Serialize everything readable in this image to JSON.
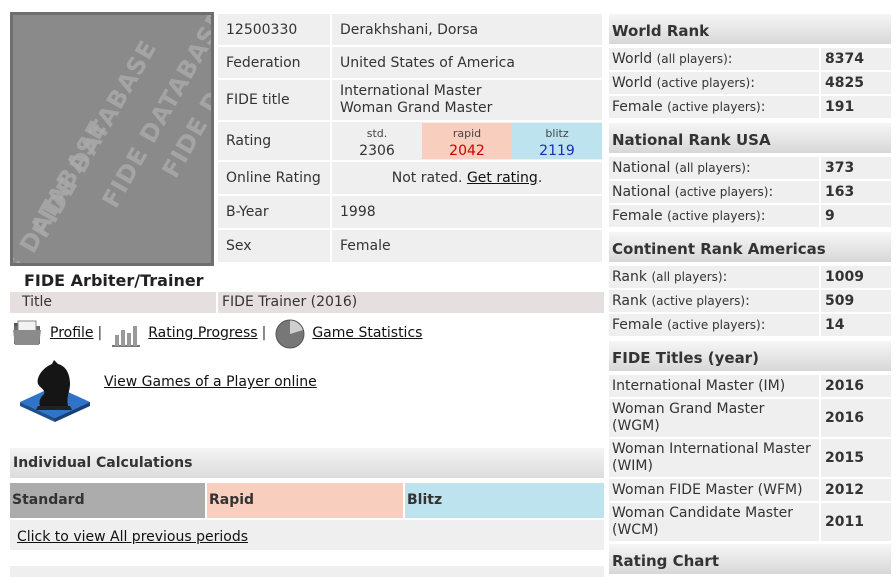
{
  "player": {
    "id": "12500330",
    "name": "Derakhshani, Dorsa",
    "federation_label": "Federation",
    "federation": "United States of America",
    "title_label": "FIDE title",
    "title_line1": "International Master",
    "title_line2": "Woman Grand Master",
    "rating_label": "Rating",
    "std_label": "std.",
    "std_value": "2306",
    "rapid_label": "rapid",
    "rapid_value": "2042",
    "blitz_label": "blitz",
    "blitz_value": "2119",
    "online_label": "Online Rating",
    "online_text": "Not rated.",
    "online_link": "Get rating",
    "online_period": ".",
    "byear_label": "B-Year",
    "byear": "1998",
    "sex_label": "Sex",
    "sex": "Female",
    "photo_watermark": [
      "FIDE DATABASE",
      "FIDE DATABASE",
      "FIDE DATABASE",
      "FIDE DATABASE"
    ]
  },
  "arbiter": {
    "heading": "FIDE Arbiter/Trainer",
    "title_label": "Title",
    "title_value": "FIDE Trainer (2016)"
  },
  "links": {
    "profile": "Profile",
    "sep": "|",
    "rating_progress": "Rating Progress",
    "game_statistics": "Game Statistics",
    "view_games": "View Games of a Player online"
  },
  "calc": {
    "heading": "Individual Calculations",
    "standard": "Standard",
    "rapid": "Rapid",
    "blitz": "Blitz",
    "prev": "Click to view All previous periods"
  },
  "world_rank": {
    "heading": "World Rank",
    "rows": [
      {
        "label": "World",
        "sub": "(all players)",
        "colon": ":",
        "value": "8374"
      },
      {
        "label": "World",
        "sub": "(active players)",
        "colon": ":",
        "value": "4825"
      },
      {
        "label": "Female",
        "sub": "(active players)",
        "colon": ":",
        "value": "191"
      }
    ]
  },
  "national_rank": {
    "heading": "National Rank USA",
    "rows": [
      {
        "label": "National",
        "sub": "(all players)",
        "colon": ":",
        "value": "373"
      },
      {
        "label": "National",
        "sub": "(active players)",
        "colon": ":",
        "value": "163"
      },
      {
        "label": "Female",
        "sub": "(active players)",
        "colon": ":",
        "value": "9"
      }
    ]
  },
  "continent_rank": {
    "heading": "Continent Rank Americas",
    "rows": [
      {
        "label": "Rank",
        "sub": "(all players)",
        "colon": ":",
        "value": "1009"
      },
      {
        "label": "Rank",
        "sub": "(active players)",
        "colon": ":",
        "value": "509"
      },
      {
        "label": "Female",
        "sub": "(active players)",
        "colon": ":",
        "value": "14"
      }
    ]
  },
  "fide_titles": {
    "heading": "FIDE Titles (year)",
    "rows": [
      {
        "line1": "International Master (IM)",
        "line2": "",
        "year": "2016"
      },
      {
        "line1": "Woman Grand Master",
        "line2": "(WGM)",
        "year": "2016"
      },
      {
        "line1": "Woman International Master",
        "line2": "(WIM)",
        "year": "2015"
      },
      {
        "line1": "Woman FIDE Master (WFM)",
        "line2": "",
        "year": "2012"
      },
      {
        "line1": "Woman Candidate Master",
        "line2": "(WCM)",
        "year": "2011"
      }
    ]
  },
  "rating_chart": {
    "heading": "Rating Chart"
  },
  "icons": [
    "folder-icon",
    "bar-chart-icon",
    "pie-chart-icon",
    "chess-knight-icon"
  ]
}
